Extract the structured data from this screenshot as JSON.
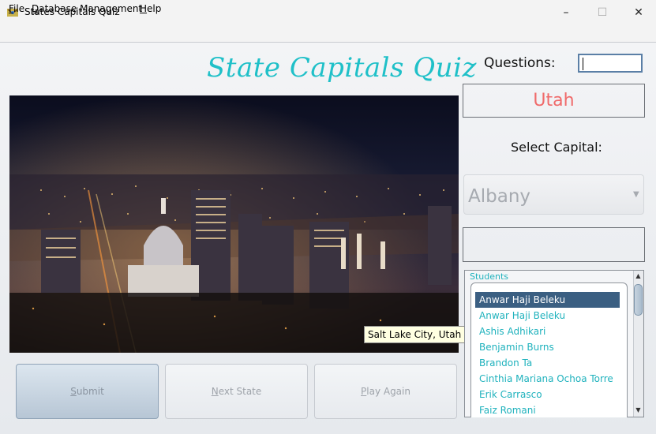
{
  "window": {
    "title": "States Capitals Quiz",
    "min_icon": "–",
    "max_icon": "☐",
    "close_icon": "✕"
  },
  "menu": {
    "items": [
      {
        "key": "F",
        "rest": "ile"
      },
      {
        "key": "D",
        "rest": "atabase Management"
      },
      {
        "key": "H",
        "rest": "elp"
      }
    ]
  },
  "quiz": {
    "title": "State Capitals Quiz",
    "photo_caption": "Salt Lake City, Utah",
    "buttons": {
      "submit": {
        "key": "S",
        "rest": "ubmit"
      },
      "next": {
        "key": "N",
        "rest": "ext State"
      },
      "again": {
        "key": "P",
        "rest": "lay Again"
      }
    }
  },
  "panel": {
    "questions_label": "Questions:",
    "questions_value": "",
    "state": "Utah",
    "select_label": "Select Capital:",
    "capital_selected": "Albany",
    "combo_arrow": "▼",
    "result": ""
  },
  "students": {
    "title": "Students",
    "items": [
      "Anwar Haji Beleku",
      "Anwar Haji Beleku",
      "Ashis Adhikari",
      "Benjamin Burns",
      "Brandon Ta",
      "Cinthia Mariana Ochoa Torre",
      "Erik Carrasco",
      "Faiz Romani"
    ],
    "selected_index": 0,
    "scroll_up": "▲",
    "scroll_down": "▼"
  },
  "colors": {
    "accent": "#1fc0c8",
    "state": "#f06a6a",
    "selection": "#3b5f82"
  }
}
